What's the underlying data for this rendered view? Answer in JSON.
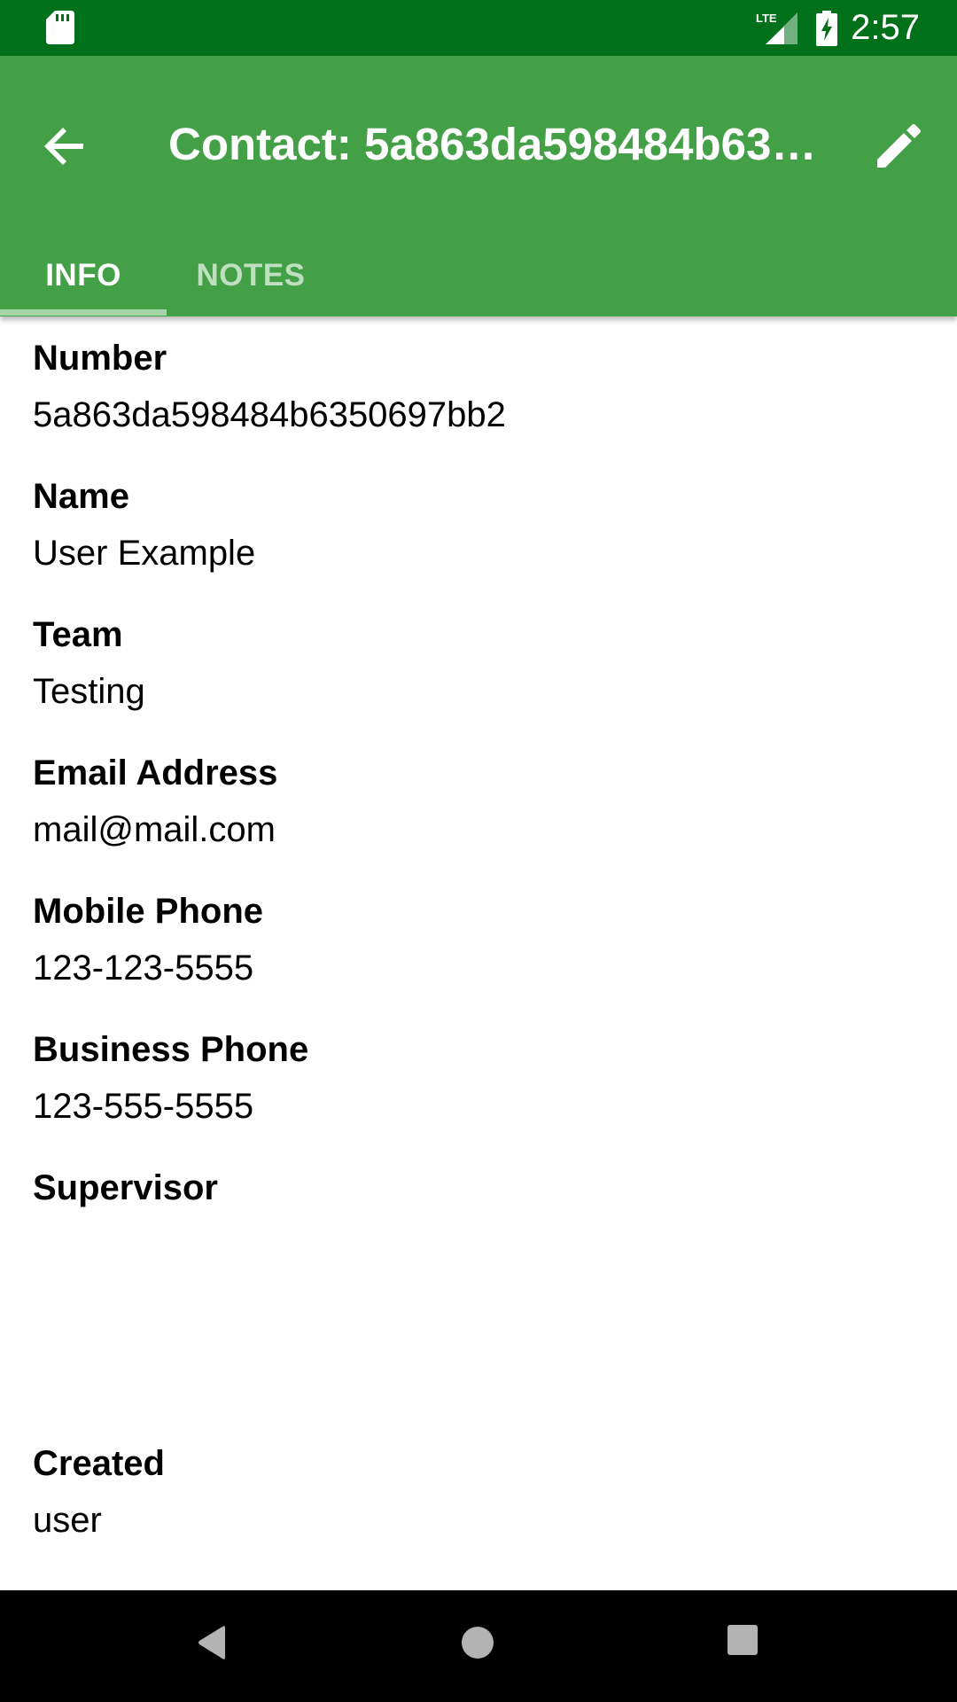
{
  "status_bar": {
    "time": "2:57",
    "network_label": "LTE",
    "icons": [
      "sd-card-icon",
      "lte-signal-icon",
      "battery-charging-icon"
    ]
  },
  "app_bar": {
    "title": "Contact: 5a863da598484b63…",
    "back_icon": "arrow-back-icon",
    "edit_icon": "pencil-icon",
    "colors": {
      "app_bar": "#43a047",
      "status_bar": "#00701a",
      "tab_indicator": "#a5d6a7"
    }
  },
  "tabs": [
    {
      "label": "INFO",
      "selected": true
    },
    {
      "label": "NOTES",
      "selected": false
    }
  ],
  "fields": [
    {
      "label": "Number",
      "value": "5a863da598484b6350697bb2"
    },
    {
      "label": "Name",
      "value": "User Example"
    },
    {
      "label": "Team",
      "value": "Testing"
    },
    {
      "label": "Email Address",
      "value": "mail@mail.com"
    },
    {
      "label": "Mobile Phone",
      "value": "123-123-5555"
    },
    {
      "label": "Business Phone",
      "value": "123-555-5555"
    },
    {
      "label": "Supervisor",
      "value": ""
    },
    {
      "label": "Created",
      "value": "user"
    }
  ],
  "nav_bar": {
    "icons": [
      "nav-back-icon",
      "nav-home-icon",
      "nav-recents-icon"
    ]
  }
}
